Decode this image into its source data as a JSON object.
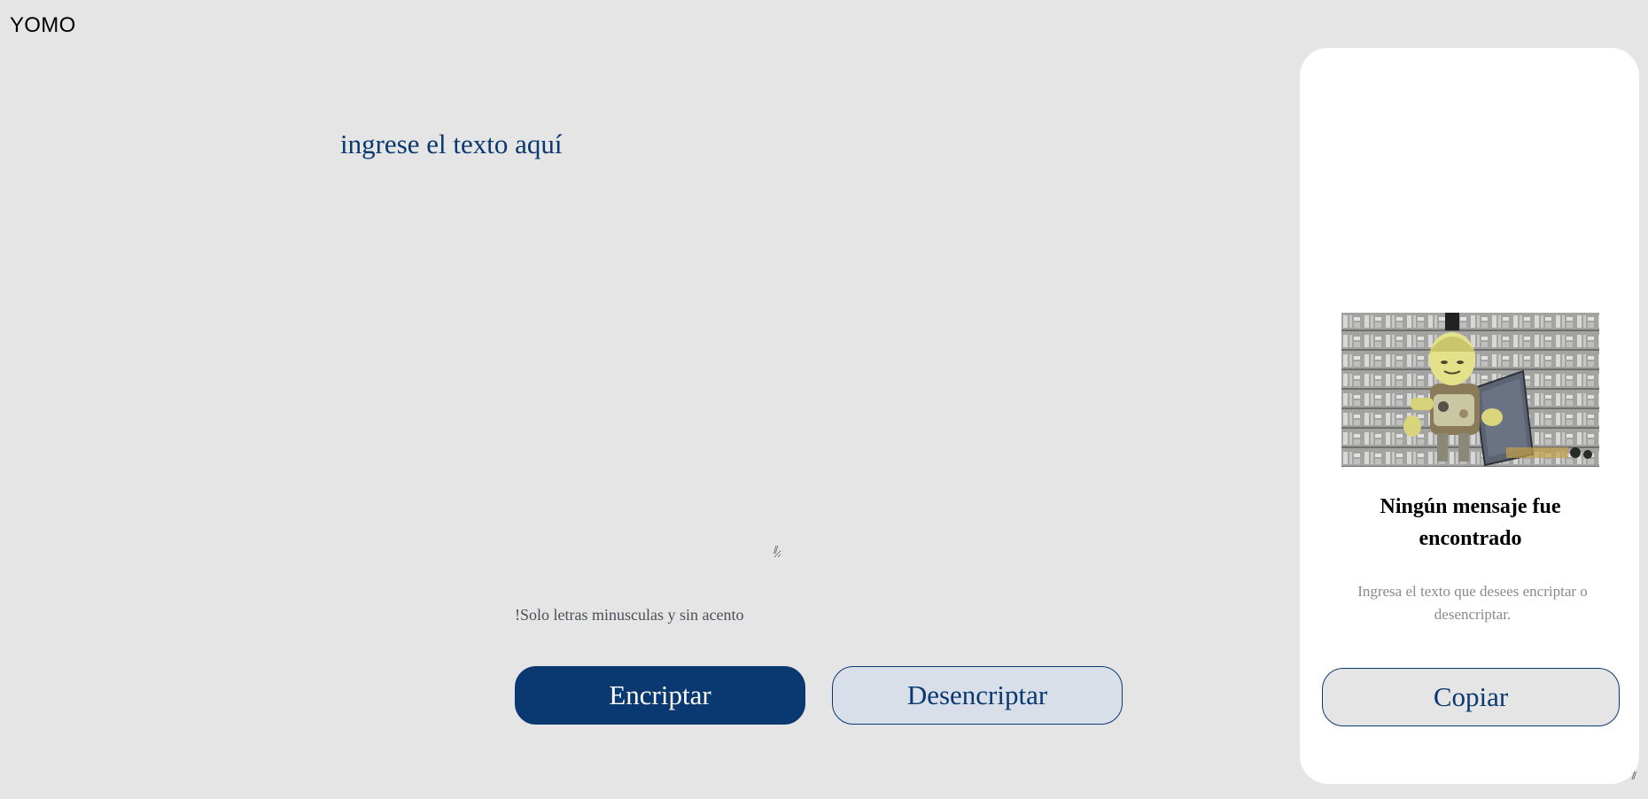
{
  "header": {
    "logo_text": "YOMO"
  },
  "editor": {
    "placeholder": "ingrese el texto aquí",
    "value": ""
  },
  "hint": {
    "icon": "exclamation-icon",
    "text": "!Solo letras minusculas y sin acento"
  },
  "actions": {
    "encrypt_label": "Encriptar",
    "decrypt_label": "Desencriptar"
  },
  "output_panel": {
    "illustration": "robot-holding-book-over-cipher-wall",
    "title": "Ningún mensaje fue encontrado",
    "subtitle": "Ingresa el texto que desees encriptar o desencriptar.",
    "copy_label": "Copiar"
  },
  "colors": {
    "background": "#e5e5e5",
    "primary": "#0a3871",
    "secondary_button_bg": "#d8dfe8",
    "panel_bg": "#ffffff",
    "muted_text": "#8a8a8a"
  }
}
